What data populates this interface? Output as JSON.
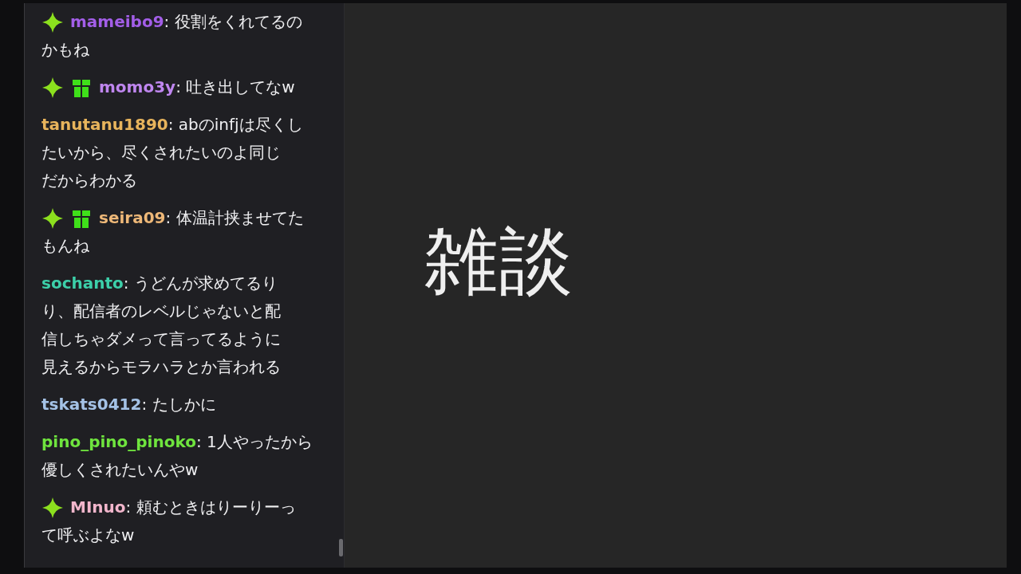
{
  "chat": {
    "messages": [
      {
        "badges": [
          {
            "kind": "sparkle"
          }
        ],
        "user": "mameibo9",
        "color": "#a35ee8",
        "separator": ":",
        "lines": [
          "役割をくれてるの",
          "かもね"
        ]
      },
      {
        "badges": [
          {
            "kind": "sparkle"
          },
          {
            "kind": "gift"
          }
        ],
        "user": "momo3y",
        "color": "#bf86ef",
        "separator": ":",
        "lines": [
          "吐き出してなw"
        ]
      },
      {
        "user": "tanutanu1890",
        "color": "#e8b45c",
        "separator": ":",
        "lines": [
          "abのinfjは尽くし",
          "たいから、尽くされたいのよ同じ",
          "だからわかる"
        ]
      },
      {
        "badges": [
          {
            "kind": "sparkle"
          },
          {
            "kind": "gift"
          }
        ],
        "user": "seira09",
        "color": "#eeb878",
        "separator": ":",
        "lines": [
          "体温計挟ませてた",
          "もんね"
        ]
      },
      {
        "user": "sochanto",
        "color": "#3ccfa9",
        "separator": ":",
        "lines": [
          "うどんが求めてるり",
          "り、配信者のレベルじゃないと配",
          "信しちゃダメって言ってるように",
          "見えるからモラハラとか言われる"
        ]
      },
      {
        "user": "tskats0412",
        "color": "#a4c2e6",
        "separator": ":",
        "lines": [
          "たしかに"
        ]
      },
      {
        "user": "pino_pino_pinoko",
        "color": "#6fe43e",
        "separator": ":",
        "lines": [
          "1人やったから",
          "優しくされたいんやw"
        ]
      },
      {
        "badges": [
          {
            "kind": "sparkle"
          }
        ],
        "user": "MInuo",
        "color": "#f2b6cc",
        "separator": ":",
        "lines": [
          "頼むときはりーりーっ",
          "て呼ぶよなw"
        ]
      }
    ]
  },
  "stage": {
    "title": "雑談"
  }
}
